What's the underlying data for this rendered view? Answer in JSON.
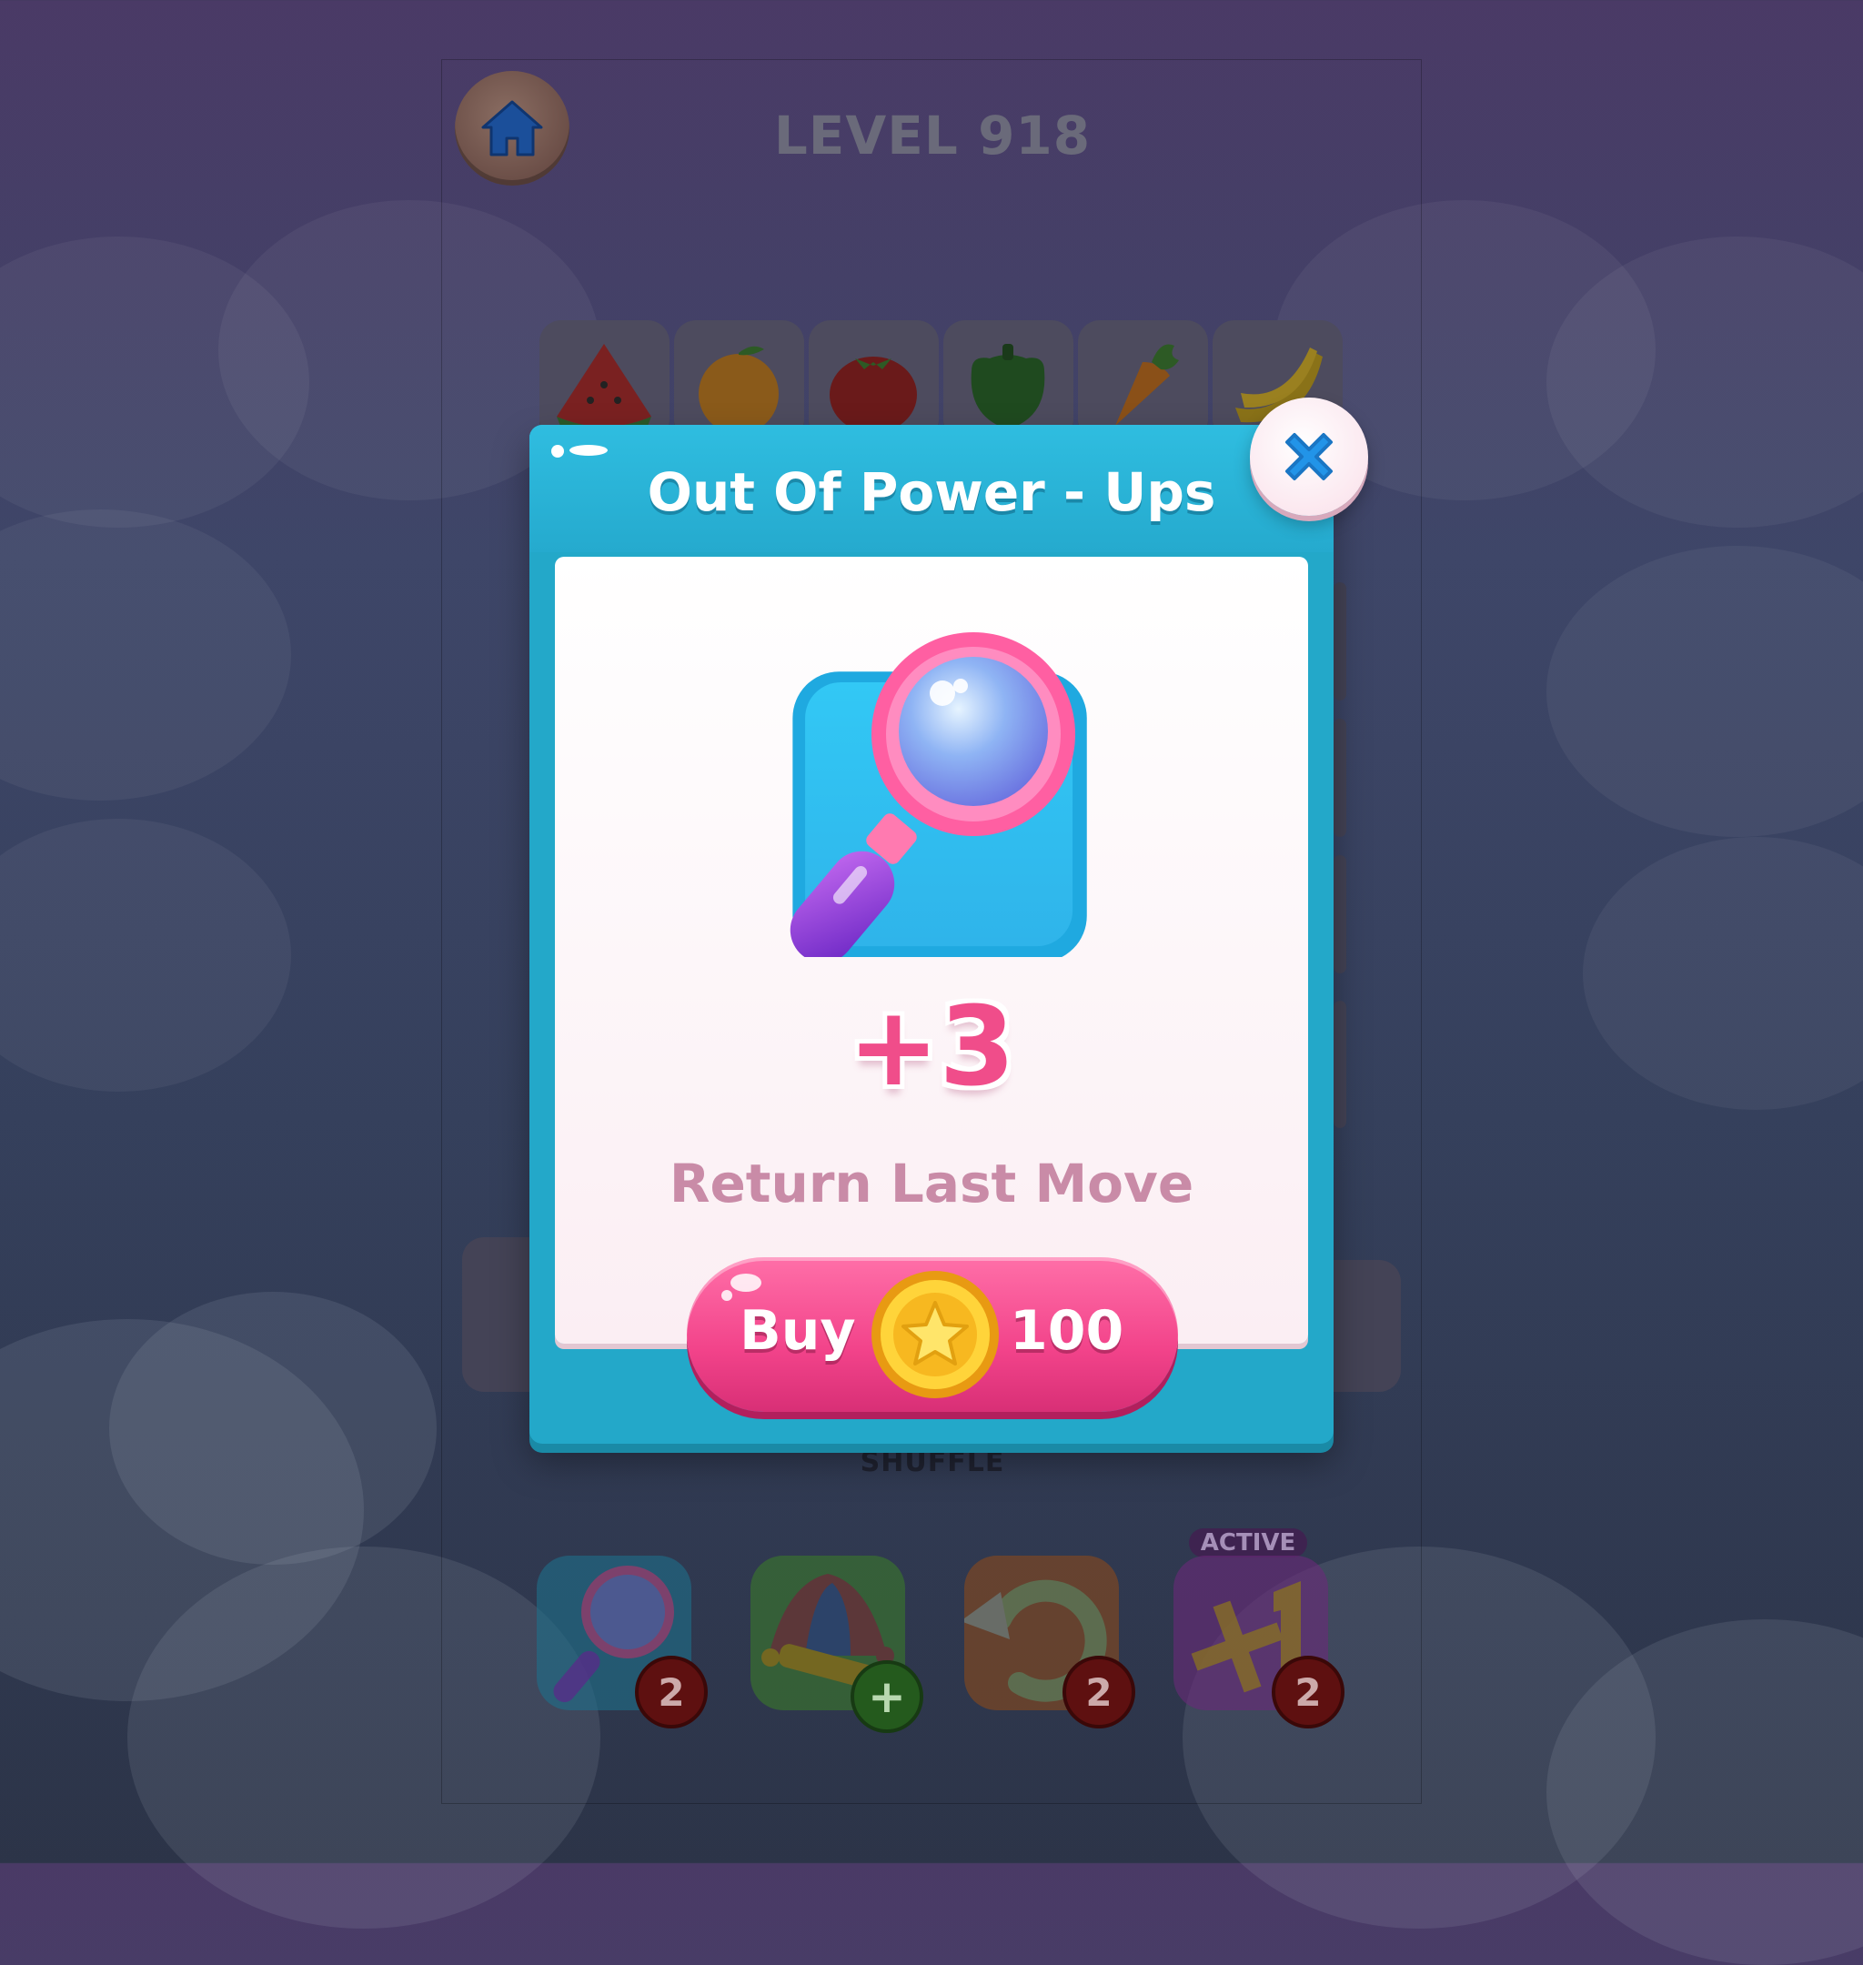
{
  "level": {
    "title": "LEVEL 918"
  },
  "board": {
    "tiles": [
      "watermelon",
      "orange",
      "tomato",
      "bell-pepper",
      "carrot",
      "banana"
    ]
  },
  "shuffle": {
    "label": "SHUFFLE"
  },
  "powerups": [
    {
      "name": "magnifier",
      "count": "2"
    },
    {
      "name": "jester-hat",
      "count": "+"
    },
    {
      "name": "undo",
      "count": "2"
    },
    {
      "name": "plus-one",
      "count": "2",
      "tag": "ACTIVE"
    }
  ],
  "modal": {
    "title": "Out Of Power - Ups",
    "reward_amount": "+3",
    "reward_name": "Return Last Move",
    "buy_label": "Buy",
    "price": "100",
    "icon": "magnifier-icon",
    "close_icon": "close-icon"
  },
  "colors": {
    "modal_frame": "#23a8c9",
    "buy_button": "#f2438a",
    "reward_text": "#f04d8a",
    "reward_name_text": "#c98ba7"
  }
}
